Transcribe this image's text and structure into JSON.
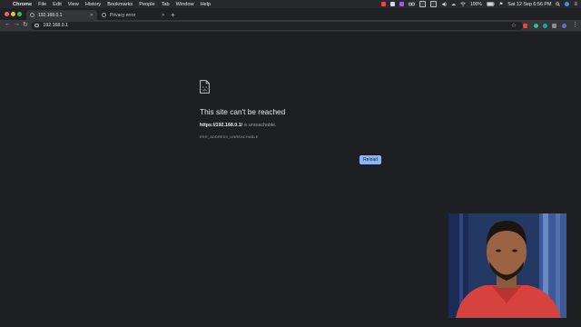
{
  "menubar": {
    "app_name": "Chrome",
    "items": [
      "File",
      "Edit",
      "View",
      "History",
      "Bookmarks",
      "People",
      "Tab",
      "Window",
      "Help"
    ],
    "status": {
      "battery": "100%",
      "datetime": "Sat 12 Sep  6:56 PM"
    }
  },
  "tabs": [
    {
      "title": "192.168.0.1",
      "active": true
    },
    {
      "title": "Privacy error",
      "active": false
    }
  ],
  "toolbar": {
    "url": "192.168.0.1"
  },
  "error": {
    "title": "This site can't be reached",
    "host": "https://192.168.0.1/",
    "message_suffix": " is unreachable.",
    "code": "ERR_ADDRESS_UNREACHABLE",
    "reload_label": "Reload"
  },
  "colors": {
    "background": "#1e1f22",
    "accent": "#8ab4f8",
    "traffic_red": "#ff5f57",
    "traffic_yellow": "#febc2e",
    "traffic_green": "#28c840"
  },
  "icons": [
    "apple-icon",
    "back-arrow-icon",
    "forward-arrow-icon",
    "reload-icon",
    "info-icon",
    "star-icon",
    "sad-document-icon",
    "wifi-icon",
    "battery-icon",
    "search-icon"
  ]
}
